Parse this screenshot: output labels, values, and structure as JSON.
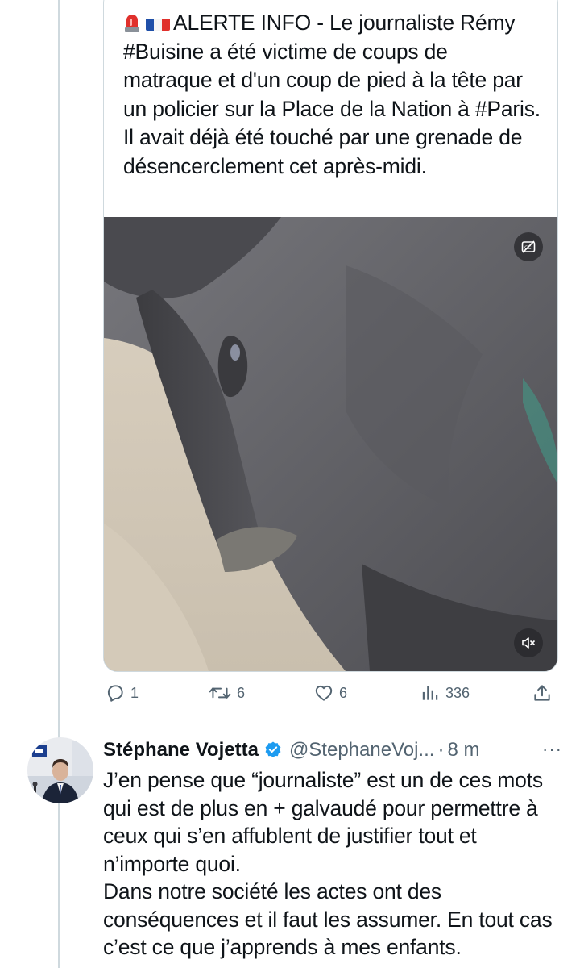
{
  "quoted_tweet": {
    "text": "ALERTE INFO - Le journaliste Rémy #Buisine a été victime de coups de matraque et d'un coup de pied à la tête par un policier sur la Place de la Nation à #Paris. Il avait déjà été touché par une grenade de désencerclement cet après-midi.",
    "emojis": [
      "siren-emoji",
      "france-flag-emoji"
    ],
    "media": {
      "type": "video",
      "captions_icon": "closed-captions-off-icon",
      "mute_icon": "speaker-muted-icon"
    },
    "stats": {
      "replies": "1",
      "retweets": "6",
      "likes": "6",
      "views": "336"
    }
  },
  "reply_tweet": {
    "author_name": "Stéphane Vojetta",
    "verified": true,
    "handle": "@StephaneVoj...",
    "separator": "·",
    "time": "8 m",
    "more_label": "···",
    "paragraphs": [
      "J’en pense que “journaliste” est un de ces mots qui est de plus en + galvaudé pour permettre à ceux qui s’en affublent de justifier tout et n’importe quoi.",
      "Dans notre société les actes ont des conséquences et il faut les assumer. En tout cas c’est ce que j’apprends à mes enfants."
    ]
  },
  "colors": {
    "text_primary": "#0f1419",
    "text_secondary": "#536471",
    "border": "#cfd9de",
    "verified_blue": "#1d9bf0"
  }
}
